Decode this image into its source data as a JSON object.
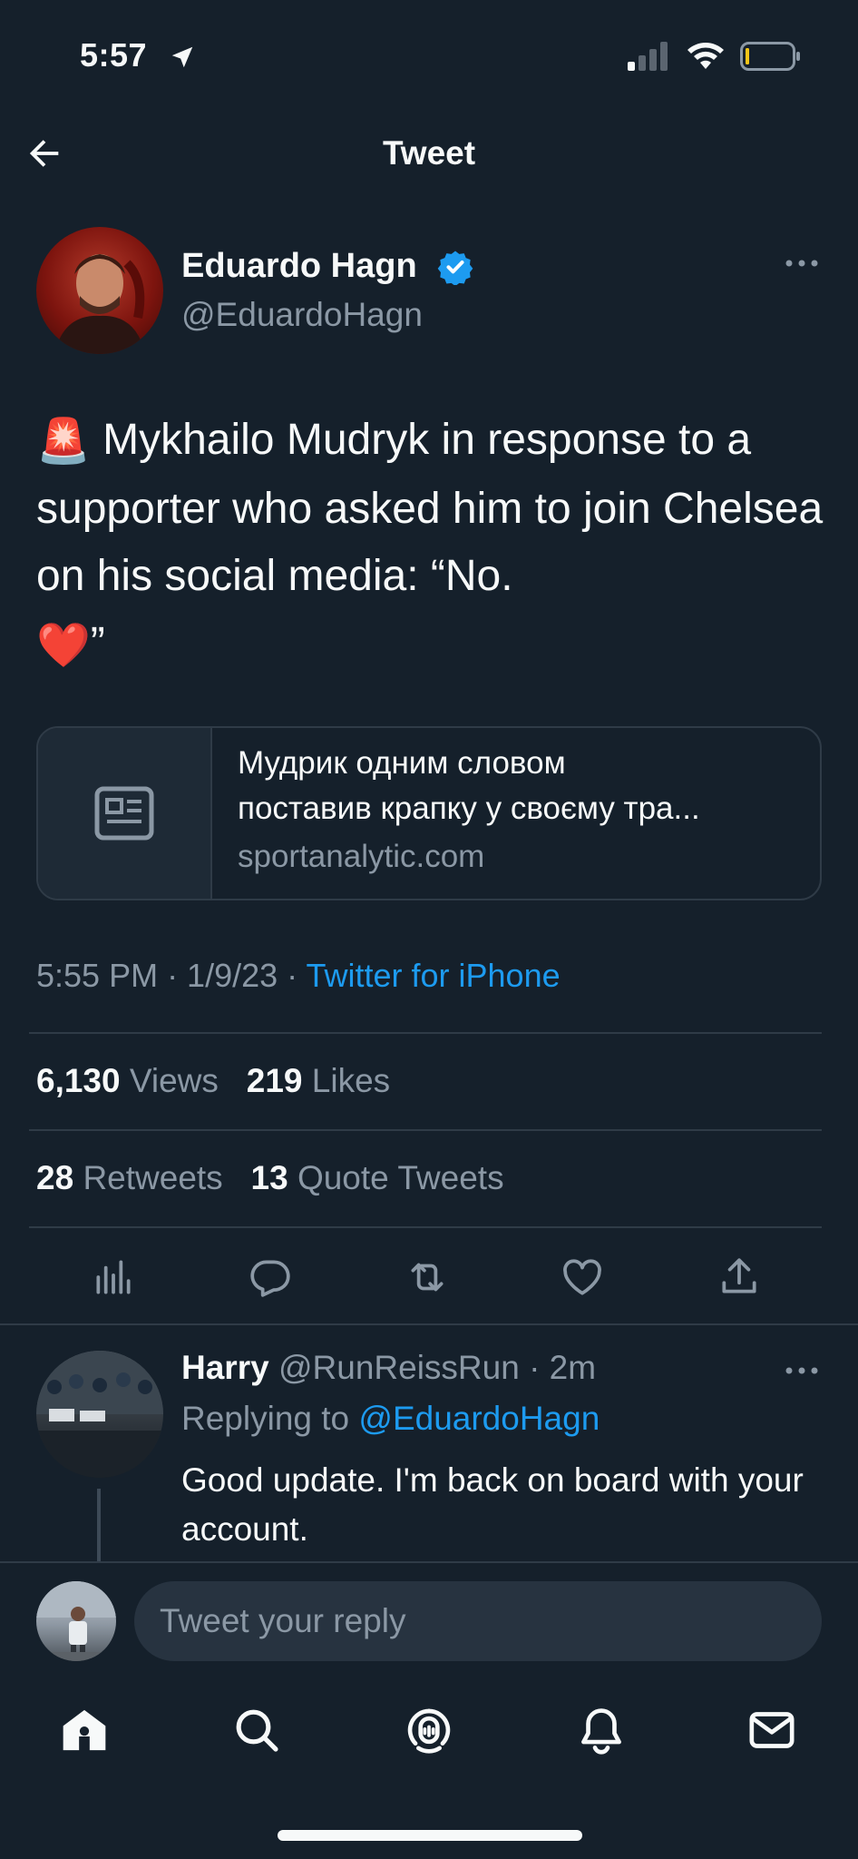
{
  "status_bar": {
    "time": "5:57"
  },
  "header": {
    "title": "Tweet"
  },
  "tweet": {
    "author_name": "Eduardo Hagn",
    "author_handle": "@EduardoHagn",
    "text_main": " Mykhailo Mudryk in response to a supporter who asked him to join Chelsea on his social media: “No.",
    "text_end": "”",
    "emoji_start": "🚨",
    "emoji_end": "❤️",
    "link_card": {
      "title_line1": "Мудрик одним словом",
      "title_line2": "поставив крапку у своєму тра...",
      "domain": "sportanalytic.com"
    },
    "timestamp": "5:55 PM · 1/9/23 · ",
    "source": "Twitter for iPhone",
    "views_count": "6,130",
    "views_label": "Views",
    "likes_count": "219",
    "likes_label": "Likes",
    "retweets_count": "28",
    "retweets_label": "Retweets",
    "quotes_count": "13",
    "quotes_label": "Quote Tweets"
  },
  "reply": {
    "name": "Harry",
    "handle_time": "@RunReissRun · 2m",
    "replying_prefix": "Replying to ",
    "replying_mention": "@EduardoHagn",
    "text": "Good update. I'm back on board with your account."
  },
  "composer": {
    "placeholder": "Tweet your reply"
  },
  "colors": {
    "background": "#15202b",
    "accent": "#1d9bf0",
    "muted": "#8b98a5",
    "divider": "#2f3b47"
  },
  "icons": [
    "location-arrow-icon",
    "cellular-signal-icon",
    "wifi-icon",
    "battery-icon",
    "back-arrow-icon",
    "verified-badge-icon",
    "more-options-icon",
    "article-icon",
    "analytics-icon",
    "reply-icon",
    "retweet-icon",
    "like-icon",
    "share-icon",
    "home-icon",
    "search-icon",
    "spaces-icon",
    "notifications-icon",
    "messages-icon"
  ]
}
